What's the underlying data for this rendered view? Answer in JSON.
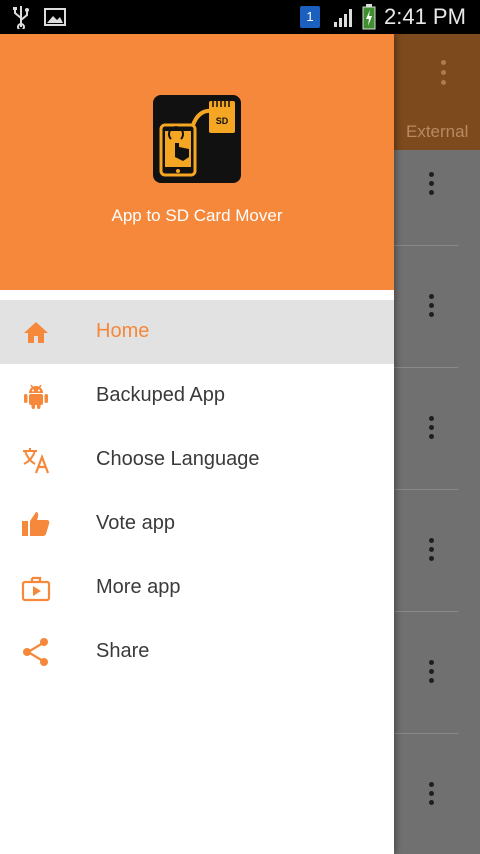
{
  "status_bar": {
    "notification_badge": "1",
    "time": "2:41 PM"
  },
  "background_app": {
    "tab_label": "External"
  },
  "drawer": {
    "app_name": "App to SD Card Mover",
    "logo_text": "SD",
    "items": [
      {
        "label": "Home",
        "icon": "home-icon",
        "active": true
      },
      {
        "label": "Backuped App",
        "icon": "android-icon"
      },
      {
        "label": "Choose Language",
        "icon": "translate-icon"
      },
      {
        "label": "Vote app",
        "icon": "thumbs-up-icon"
      },
      {
        "label": "More app",
        "icon": "briefcase-play-icon"
      },
      {
        "label": "Share",
        "icon": "share-icon"
      }
    ]
  },
  "colors": {
    "accent": "#f5883a",
    "active_bg": "#e2e2e2",
    "text": "#3a3a3a"
  }
}
